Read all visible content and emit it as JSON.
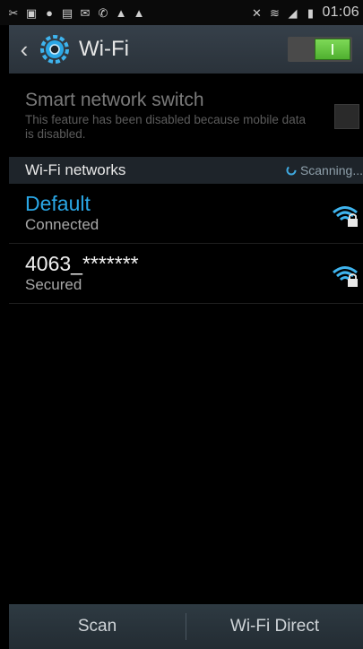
{
  "status_bar": {
    "icons_left": [
      "missed-call-icon",
      "gallery-icon",
      "chat-icon",
      "screenshot-icon",
      "message-icon",
      "call-icon",
      "alert-icon",
      "alert-icon"
    ],
    "icons_right": [
      "mute-icon",
      "wifi-signal-icon",
      "cell-signal-icon",
      "battery-icon"
    ],
    "time": "01:06"
  },
  "action_bar": {
    "title": "Wi-Fi",
    "toggle_on": true
  },
  "smart_network": {
    "title": "Smart network switch",
    "subtitle": "This feature has been disabled because mobile data is disabled."
  },
  "section": {
    "label": "Wi-Fi networks",
    "scanning": "Scanning..."
  },
  "networks": [
    {
      "name": "Default",
      "status": "Connected"
    },
    {
      "name": "4063_*******",
      "status": "Secured"
    }
  ],
  "bottom_bar": {
    "scan": "Scan",
    "wifi_direct": "Wi-Fi Direct"
  },
  "colors": {
    "accent": "#2aa7e6",
    "toggle_on": "#5fc43a",
    "action_bar": "#323c45"
  }
}
